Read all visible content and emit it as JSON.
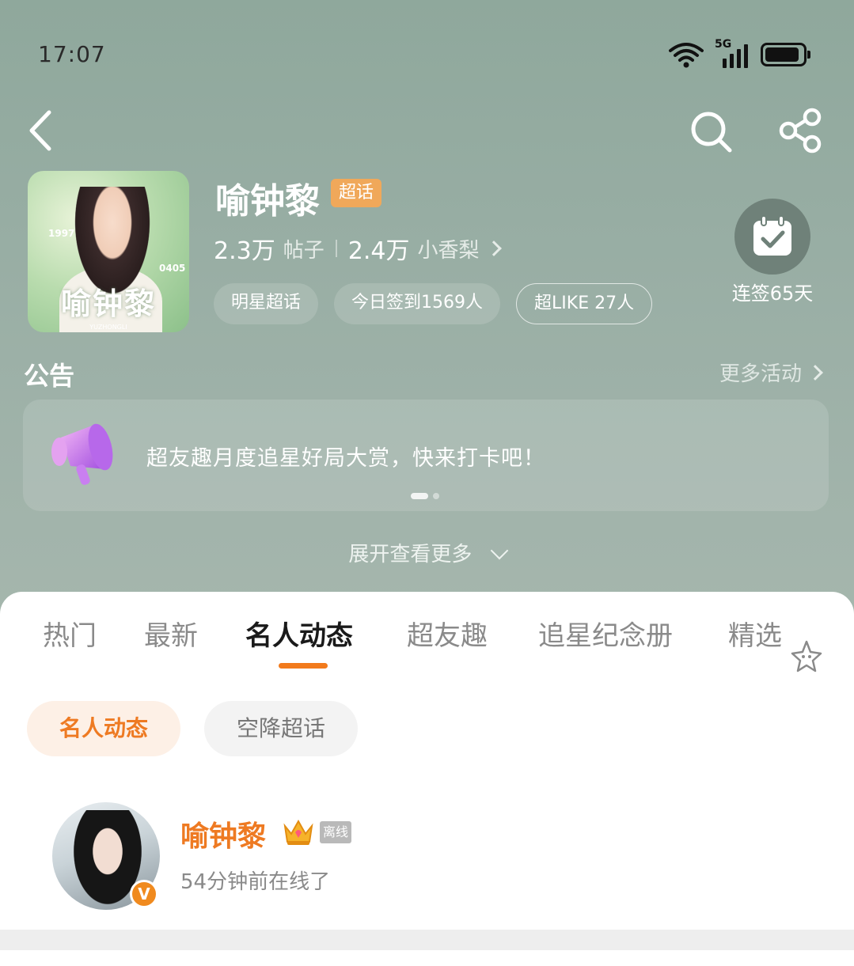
{
  "status_bar": {
    "time": "17:07",
    "network": "5G",
    "icons": [
      "wifi-icon",
      "signal-icon",
      "battery-icon"
    ]
  },
  "nav": {
    "icons": [
      "back-icon",
      "search-icon",
      "share-icon"
    ]
  },
  "topic": {
    "name": "喻钟黎",
    "badge": "超话",
    "cover_name": "喻钟黎",
    "cover_pinyin": "YUZHONGLI",
    "cover_year_1": "1997",
    "cover_year_2": "0405",
    "posts_count": "2.3万",
    "posts_label": "帖子",
    "fans_count": "2.4万",
    "fans_label": "小香梨",
    "tags": [
      "明星超话",
      "今日签到1569人",
      "超LIKE 27人"
    ],
    "checkin_text": "连签65天"
  },
  "notice": {
    "title": "公告",
    "more_label": "更多活动",
    "text": "超友趣月度追星好局大赏，快来打卡吧！",
    "expand_label": "展开查看更多"
  },
  "tabs": [
    {
      "label": "热门"
    },
    {
      "label": "最新"
    },
    {
      "label": "名人动态"
    },
    {
      "label": "超友趣"
    },
    {
      "label": "追星纪念册"
    },
    {
      "label": "精选"
    }
  ],
  "active_tab": "名人动态",
  "sub_chips": [
    {
      "label": "名人动态",
      "active": true
    },
    {
      "label": "空降超话",
      "active": false
    }
  ],
  "celebrity": {
    "name": "喻钟黎",
    "status_badge": "离线",
    "last_seen": "54分钟前在线了",
    "verified_mark": "V"
  },
  "colors": {
    "accent": "#f27a1c",
    "header_bg": "#97ada3",
    "badge_bg": "#f0a85a"
  }
}
